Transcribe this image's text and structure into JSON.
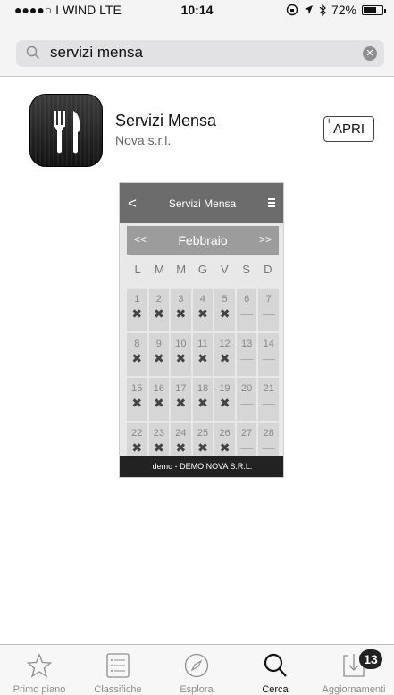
{
  "status_bar": {
    "carrier": "●●●●○ I WIND  LTE",
    "time": "10:14",
    "battery": "72%",
    "battery_level": 0.72
  },
  "search": {
    "query": "servizi mensa",
    "clear_icon": "clear-circle-icon"
  },
  "app": {
    "name": "Servizi Mensa",
    "developer": "Nova s.r.l.",
    "open_label": "APRI",
    "plus": "+"
  },
  "preview": {
    "header_title": "Servizi Mensa",
    "back": "<",
    "month": "Febbraio",
    "prev": "<<",
    "next": ">>",
    "weekdays": [
      "L",
      "M",
      "M",
      "G",
      "V",
      "S",
      "D"
    ],
    "days": [
      {
        "n": "1",
        "m": "✖"
      },
      {
        "n": "2",
        "m": "✖"
      },
      {
        "n": "3",
        "m": "✖"
      },
      {
        "n": "4",
        "m": "✖"
      },
      {
        "n": "5",
        "m": "✖"
      },
      {
        "n": "6",
        "m": "—"
      },
      {
        "n": "7",
        "m": "—"
      },
      {
        "n": "8",
        "m": "✖"
      },
      {
        "n": "9",
        "m": "✖"
      },
      {
        "n": "10",
        "m": "✖"
      },
      {
        "n": "11",
        "m": "✖"
      },
      {
        "n": "12",
        "m": "✖"
      },
      {
        "n": "13",
        "m": "—"
      },
      {
        "n": "14",
        "m": "—"
      },
      {
        "n": "15",
        "m": "✖"
      },
      {
        "n": "16",
        "m": "✖"
      },
      {
        "n": "17",
        "m": "✖"
      },
      {
        "n": "18",
        "m": "✖"
      },
      {
        "n": "19",
        "m": "✖"
      },
      {
        "n": "20",
        "m": "—"
      },
      {
        "n": "21",
        "m": "—"
      },
      {
        "n": "22",
        "m": "✖"
      },
      {
        "n": "23",
        "m": "✖"
      },
      {
        "n": "24",
        "m": "✖"
      },
      {
        "n": "25",
        "m": "✖"
      },
      {
        "n": "26",
        "m": "✖"
      },
      {
        "n": "27",
        "m": "—"
      },
      {
        "n": "28",
        "m": "—"
      }
    ],
    "footer": "demo - DEMO NOVA S.R.L."
  },
  "tabs": [
    {
      "label": "Primo piano",
      "icon": "star-icon",
      "active": false
    },
    {
      "label": "Classifiche",
      "icon": "list-icon",
      "active": false
    },
    {
      "label": "Esplora",
      "icon": "compass-icon",
      "active": false
    },
    {
      "label": "Cerca",
      "icon": "search-icon",
      "active": true
    },
    {
      "label": "Aggiornamenti",
      "icon": "download-icon",
      "active": false,
      "badge": "13"
    }
  ]
}
